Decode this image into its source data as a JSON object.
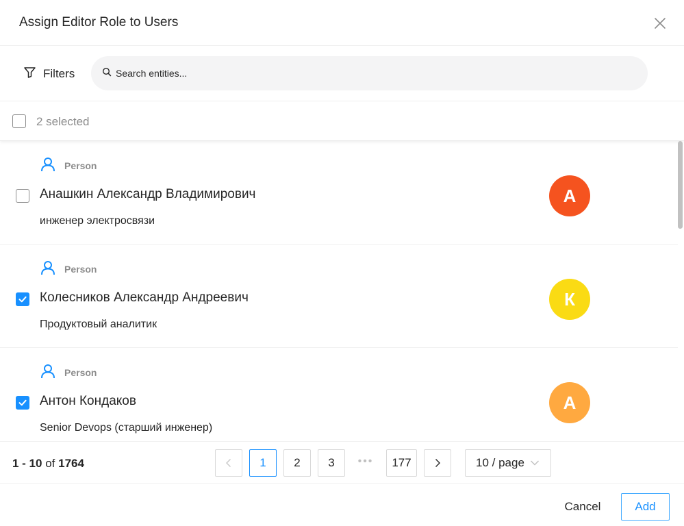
{
  "dialog": {
    "title": "Assign Editor Role to Users",
    "close_icon": "close-icon"
  },
  "toolbar": {
    "filters_label": "Filters",
    "filter_icon": "filter-icon",
    "search_placeholder": "Search entities...",
    "search_icon": "search-icon"
  },
  "selection": {
    "label": "2 selected",
    "all_checked": false
  },
  "results": [
    {
      "type": "Person",
      "name": "Анашкин Александр Владимирович",
      "role": "инженер электросвязи",
      "initial": "А",
      "avatar_color": "#f5531f",
      "checked": false
    },
    {
      "type": "Person",
      "name": "Колесников Александр Андреевич",
      "role": "Продуктовый аналитик",
      "initial": "К",
      "avatar_color": "#fadb14",
      "checked": true
    },
    {
      "type": "Person",
      "name": "Антон Кондаков",
      "role": "Senior Devops (старший инженер)",
      "initial": "А",
      "avatar_color": "#ffa940",
      "checked": true
    }
  ],
  "pagination": {
    "range": "1 - 10",
    "of": "of",
    "total": "1764",
    "pages": [
      "1",
      "2",
      "3",
      "177"
    ],
    "ellipsis": "•••",
    "current": "1",
    "page_size": "10 / page"
  },
  "footer": {
    "cancel_label": "Cancel",
    "add_label": "Add"
  },
  "colors": {
    "primary": "#1890ff",
    "person_icon": "#1890ff"
  }
}
